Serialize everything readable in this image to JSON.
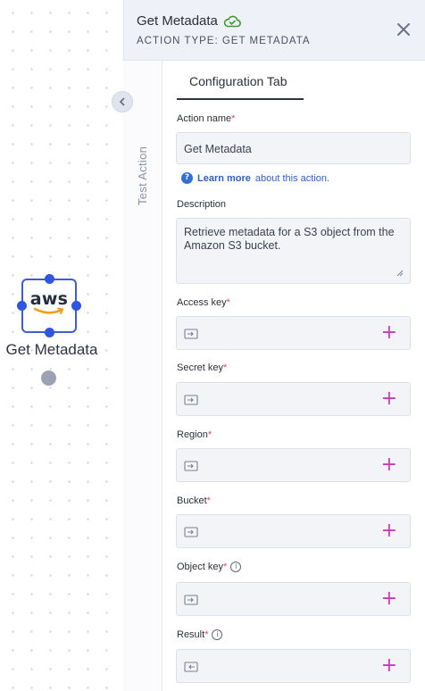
{
  "canvas": {
    "node": {
      "logo_text": "aws",
      "label": "Get Metadata"
    }
  },
  "panel": {
    "title": "Get Metadata",
    "subtitle": "ACTION TYPE: GET METADATA",
    "side_tab": "Test Action",
    "active_tab": "Configuration Tab",
    "status_icon": "cloud-check-icon",
    "accent_color": "#2f56e0",
    "plus_color": "#c13fb4"
  },
  "form": {
    "action_name": {
      "label": "Action name",
      "value": "Get Metadata"
    },
    "learn_more": {
      "link": "Learn more",
      "rest": "about this action."
    },
    "description": {
      "label": "Description",
      "value": "Retrieve metadata for a S3 object from the Amazon S3 bucket."
    },
    "fields": [
      {
        "label": "Access key"
      },
      {
        "label": "Secret key"
      },
      {
        "label": "Region"
      },
      {
        "label": "Bucket"
      },
      {
        "label": "Object key"
      },
      {
        "label": "Result"
      }
    ],
    "required_marker": "*",
    "plus_symbol": "+"
  }
}
